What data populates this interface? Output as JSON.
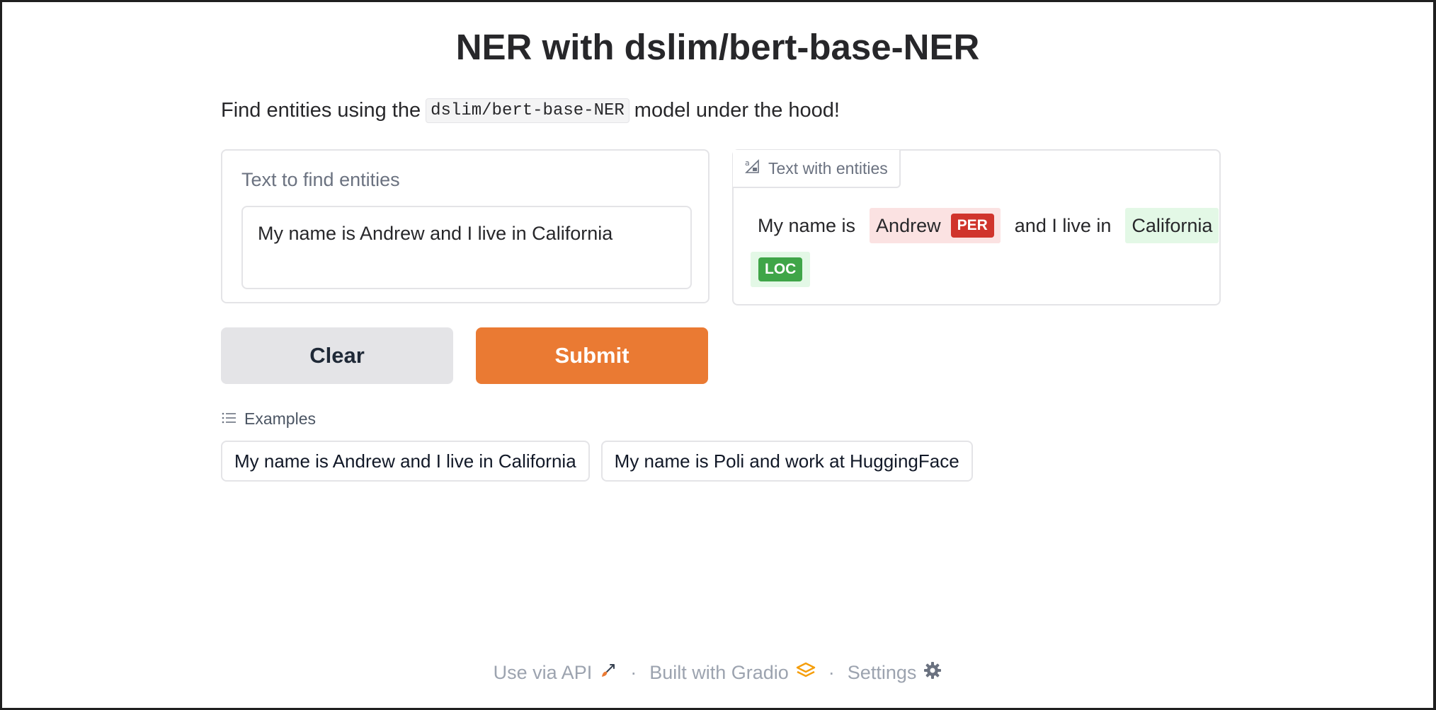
{
  "header": {
    "title": "NER with dslim/bert-base-NER",
    "desc_prefix": "Find entities using the",
    "desc_code": "dslim/bert-base-NER",
    "desc_suffix": "model under the hood!"
  },
  "input_panel": {
    "label": "Text to find entities",
    "value": "My name is Andrew and I live in California"
  },
  "output_panel": {
    "tab_label": "Text with entities",
    "tab_icon": "highlighted-text-icon",
    "segments": [
      {
        "text": "My name is",
        "entity": null
      },
      {
        "text": "Andrew",
        "entity": "PER",
        "color": "#d0342c",
        "bg": "#fbe2e2"
      },
      {
        "text": "and I live in",
        "entity": null
      },
      {
        "text": "California",
        "entity": "LOC",
        "color": "#3fa548",
        "bg": "#e3f8e6"
      }
    ]
  },
  "buttons": {
    "clear_label": "Clear",
    "submit_label": "Submit",
    "submit_color": "#ea7a33"
  },
  "examples": {
    "label": "Examples",
    "icon": "list-icon",
    "items": [
      "My name is Andrew and I live in California",
      "My name is Poli and work at HuggingFace"
    ]
  },
  "footer": {
    "api_label": "Use via API",
    "api_icon": "rocket-icon",
    "separator": "·",
    "built_label": "Built with Gradio",
    "gradio_icon": "gradio-logo-icon",
    "settings_label": "Settings",
    "settings_icon": "gear-icon"
  }
}
